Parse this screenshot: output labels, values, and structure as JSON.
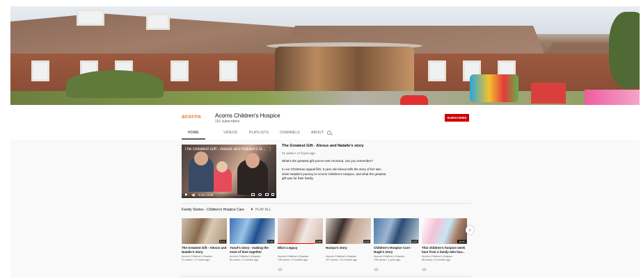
{
  "channel": {
    "name": "Acorns Children's Hospice",
    "subscribers": "231 subscribers",
    "logo_text": "acorns",
    "subscribe_label": "SUBSCRIBE"
  },
  "tabs": [
    {
      "label": "HOME"
    },
    {
      "label": "VIDEOS"
    },
    {
      "label": "PLAYLISTS"
    },
    {
      "label": "CHANNELS"
    },
    {
      "label": "ABOUT"
    }
  ],
  "featured": {
    "player_title": "The Greatest Gift - Alexus and Natalie's st...",
    "time": "0:15 / 2:00",
    "title": "The Greatest Gift - Alexus and Natalie's story",
    "meta": "21 views • 17 hours ago",
    "desc1": "What's the greatest gift you've ever received, can you remember?",
    "desc2": "In our Christmas Appeal film, 5 year old Alexus tells the story of her twin sister Natalie's journey to Acorns Children's Hospice, and what the greatest gift was for their family."
  },
  "shelf": {
    "title": "Family Stories - Children's Hospice Care",
    "play_all": "PLAY ALL"
  },
  "videos": [
    {
      "title": "The Greatest Gift - Alexus and Natalie's story",
      "channel": "Acorns Children's Hospice",
      "meta": "21 views • 17 hours ago",
      "duration": "2:01",
      "cc": ""
    },
    {
      "title": "Yusuf's story - making the most of time together",
      "channel": "Acorns Children's Hospice",
      "meta": "84 views • 2 months ago",
      "duration": "2:16",
      "cc": ""
    },
    {
      "title": "Ella's Legacy",
      "channel": "Acorns Children's Hospice",
      "meta": "145 views • 3 months ago",
      "duration": "3:38",
      "cc": "CC"
    },
    {
      "title": "Haniya's story",
      "channel": "Acorns Children's Hospice",
      "meta": "197 views • 11 months ago",
      "duration": "4:12",
      "cc": ""
    },
    {
      "title": "Children's Hospice Care - Hugh's story",
      "channel": "Acorns Children's Hospice",
      "meta": "728 views • 1 year ago",
      "duration": "4:22",
      "cc": "CC"
    },
    {
      "title": "This children's hospice week hear from a family who hav...",
      "channel": "Acorns Children's Hospice",
      "meta": "96 views • 5 months ago",
      "duration": "10:50",
      "cc": "CC"
    }
  ],
  "colors": {
    "subscribe": "#cc0000",
    "progress": "#ff0000",
    "logo": "#e8772a"
  }
}
